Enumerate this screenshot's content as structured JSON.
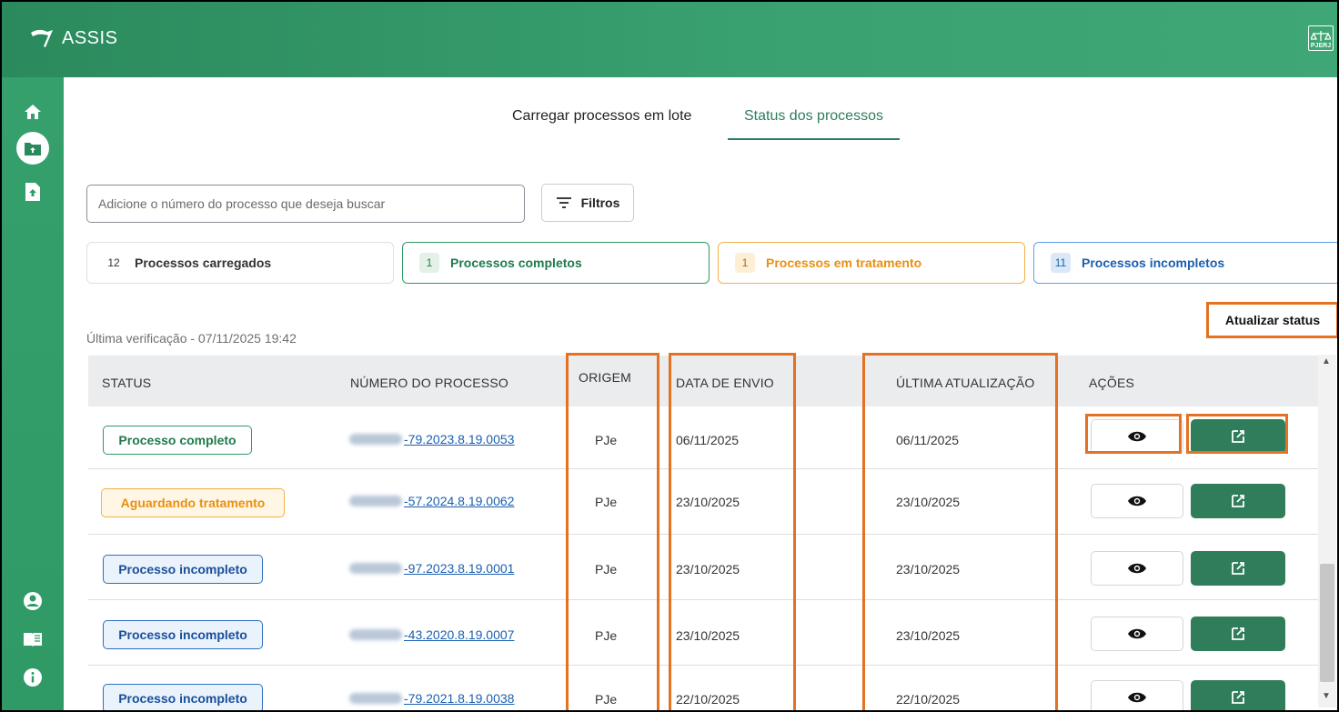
{
  "app": {
    "title": "ASSIS",
    "court_logo_text": "PJERJ"
  },
  "sidebar": {
    "top_items": [
      {
        "icon": "home-icon"
      },
      {
        "icon": "upload-folder-icon"
      },
      {
        "icon": "upload-file-icon"
      }
    ],
    "bottom_items": [
      {
        "icon": "user-icon"
      },
      {
        "icon": "manual-book-icon"
      },
      {
        "icon": "info-icon"
      }
    ]
  },
  "tabs": [
    {
      "label": "Carregar processos em lote",
      "active": false
    },
    {
      "label": "Status dos processos",
      "active": true
    }
  ],
  "search": {
    "placeholder": "Adicione o número do processo que deseja buscar"
  },
  "filters": {
    "label": "Filtros"
  },
  "summary": [
    {
      "count": "12",
      "label": "Processos carregados"
    },
    {
      "count": "1",
      "label": "Processos completos"
    },
    {
      "count": "1",
      "label": "Processos em tratamento"
    },
    {
      "count": "11",
      "label": "Processos incompletos"
    }
  ],
  "last_check": "Última verificação - 07/11/2025 19:42",
  "refresh_button": "Atualizar status",
  "table": {
    "headers": {
      "status": "STATUS",
      "number": "NÚMERO DO PROCESSO",
      "origin": "ORIGEM",
      "sent": "DATA DE ENVIO",
      "updated": "ÚLTIMA ATUALIZAÇÃO",
      "actions": "AÇÕES"
    },
    "rows": [
      {
        "status": "Processo completo",
        "number": "-79.2023.8.19.0053",
        "origin": "PJe",
        "sent": "06/11/2025",
        "updated": "06/11/2025"
      },
      {
        "status": "Aguardando tratamento",
        "number": "-57.2024.8.19.0062",
        "origin": "PJe",
        "sent": "23/10/2025",
        "updated": "23/10/2025"
      },
      {
        "status": "Processo incompleto",
        "number": "-97.2023.8.19.0001",
        "origin": "PJe",
        "sent": "23/10/2025",
        "updated": "23/10/2025"
      },
      {
        "status": "Processo incompleto",
        "number": "-43.2020.8.19.0007",
        "origin": "PJe",
        "sent": "23/10/2025",
        "updated": "23/10/2025"
      },
      {
        "status": "Processo incompleto",
        "number": "-79.2021.8.19.0038",
        "origin": "PJe",
        "sent": "22/10/2025",
        "updated": "22/10/2025"
      }
    ]
  },
  "colors": {
    "brand_green": "#2f9a66",
    "highlight_orange": "#e37222",
    "complete": "#1f7a4c",
    "pending": "#e89011",
    "incomplete": "#1a4f9a"
  }
}
